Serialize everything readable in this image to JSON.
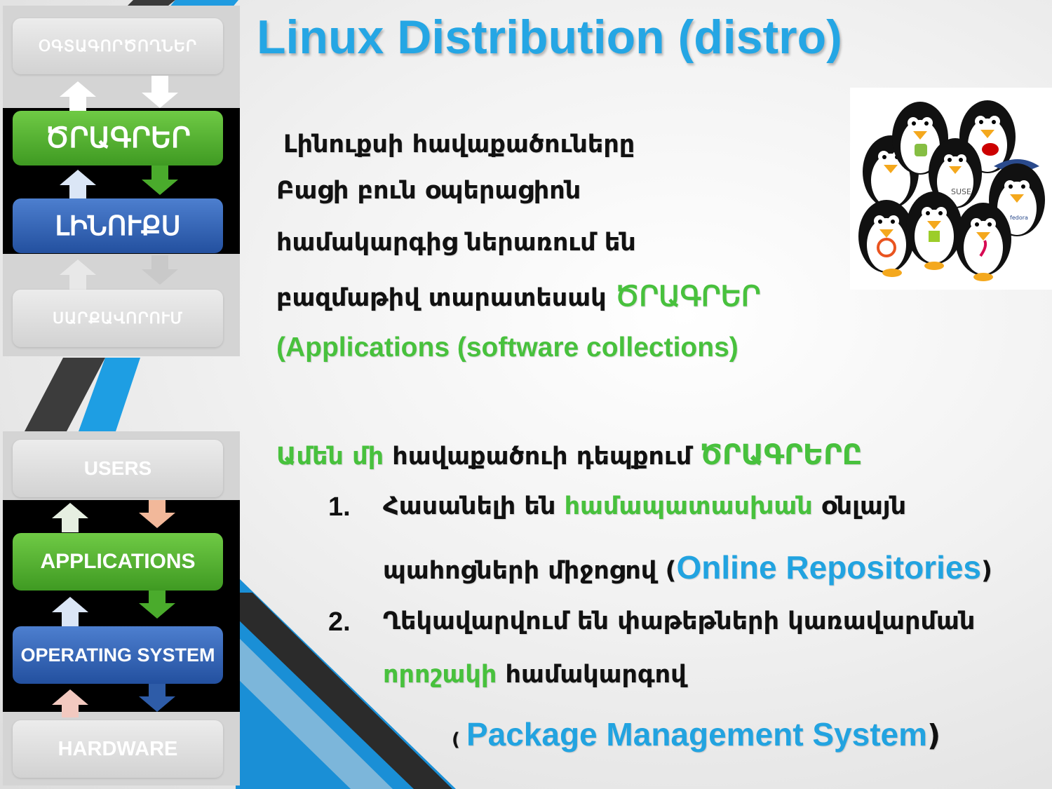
{
  "title": "Linux Distribution (distro)",
  "diagram_top": {
    "users": "ՕԳՏԱԳՈՐԾՈՂՆԵՐ",
    "applications": "ԾՐԱԳՐԵՐ",
    "os": "ԼԻՆՈՒՔՍ",
    "hardware": "ՍԱՐՔԱՎՈՐՈՒՄ"
  },
  "diagram_bottom": {
    "users": "USERS",
    "applications": "APPLICATIONS",
    "os": "OPERATING SYSTEM",
    "hardware": "HARDWARE"
  },
  "intro": {
    "line1": "Լինուքսի հավաքածուները",
    "line2": "Բացի բուն օպերացիոն",
    "line3": "համակարգից ներառում են",
    "line4_text": "բազմաթիվ  տարատեսակ ",
    "line4_highlight": "ԾՐԱԳՐԵՐ",
    "line5": "(Applications (software collections)"
  },
  "section2": {
    "lead_green": "Ամեն մի",
    "lead_text": " հավաքածուի դեպքում ",
    "lead_highlight": "ԾՐԱԳՐԵՐԸ",
    "item1": {
      "number": "1.",
      "text_a": "Հասանելի են ",
      "highlight": "համապատասխան",
      "text_b": " օնլայն",
      "line2_text": "պահոցների միջոցով (",
      "line2_blue": "Online Repositories",
      "line2_close": ")"
    },
    "item2": {
      "number": "2.",
      "text": "Ղեկավարվում են փաթեթների կառավարման",
      "line2_green": "որոշակի",
      "line2_text": " համակարգով",
      "line3_open": "( ",
      "line3_blue": "Package Management System",
      "line3_close": ")"
    }
  },
  "logo_labels": {
    "suse": "SUSE",
    "fedora": "fedora"
  },
  "colors": {
    "title_blue": "#25a6e4",
    "highlight_green": "#48c13d",
    "highlight_blue": "#22a3e0",
    "box_green": "#4aab2c",
    "box_blue": "#2e5ca8"
  }
}
